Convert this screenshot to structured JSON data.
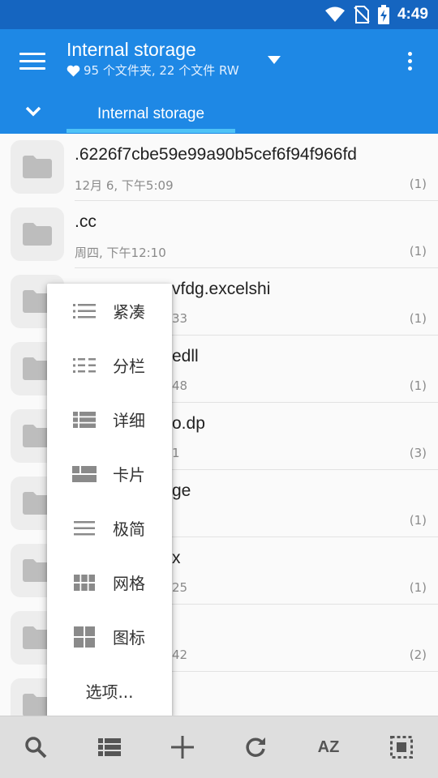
{
  "status_bar": {
    "time": "4:49"
  },
  "app_bar": {
    "title": "Internal storage",
    "subtitle": "95 个文件夹, 22 个文件 RW",
    "tab_label": "Internal storage",
    "accent_color": "#1e88e5",
    "indicator_color": "#4fc3f7"
  },
  "files": [
    {
      "name": ".6226f7cbe59e99a90b5cef6f94f966fd",
      "date": "12月 6, 下午5:09",
      "count": "(1)"
    },
    {
      "name": ".cc",
      "date": "周四, 下午12:10",
      "count": "(1)"
    },
    {
      "name": "vfdg.excelshi",
      "date": "33",
      "count": "(1)"
    },
    {
      "name": "edll",
      "date": "48",
      "count": "(1)"
    },
    {
      "name": "o.dp",
      "date": "1",
      "count": "(3)"
    },
    {
      "name": "ge",
      "date": "",
      "count": "(1)"
    },
    {
      "name": "x",
      "date": "25",
      "count": "(1)"
    },
    {
      "name": "",
      "date": "42",
      "count": "(2)"
    },
    {
      "name": "",
      "date": "",
      "count": ""
    }
  ],
  "view_menu": {
    "items": [
      {
        "label": "紧凑",
        "icon": "list-compact-icon"
      },
      {
        "label": "分栏",
        "icon": "list-columns-icon"
      },
      {
        "label": "详细",
        "icon": "list-detailed-icon"
      },
      {
        "label": "卡片",
        "icon": "cards-icon"
      },
      {
        "label": "极简",
        "icon": "minimal-icon"
      },
      {
        "label": "网格",
        "icon": "grid-icon"
      },
      {
        "label": "图标",
        "icon": "icons-view-icon"
      }
    ],
    "options_label": "选项..."
  },
  "toolbar": {
    "sort_label": "AZ"
  }
}
